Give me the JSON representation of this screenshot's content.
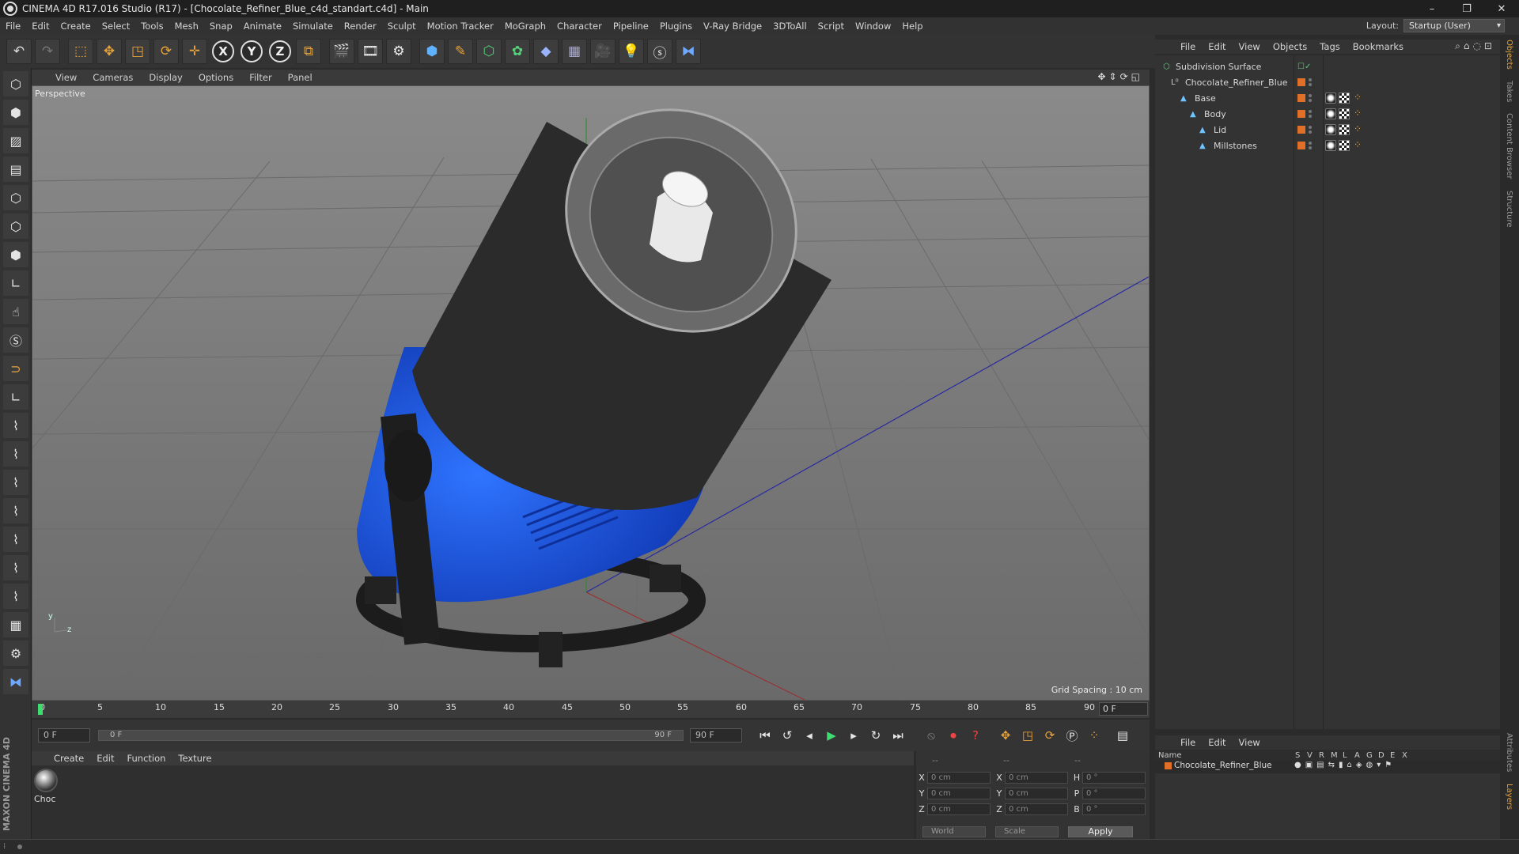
{
  "window": {
    "title": "CINEMA 4D R17.016 Studio (R17) - [Chocolate_Refiner_Blue_c4d_standart.c4d] - Main",
    "controls": [
      "–",
      "❐",
      "✕"
    ]
  },
  "menubar": {
    "items": [
      "File",
      "Edit",
      "Create",
      "Select",
      "Tools",
      "Mesh",
      "Snap",
      "Animate",
      "Simulate",
      "Render",
      "Sculpt",
      "Motion Tracker",
      "MoGraph",
      "Character",
      "Pipeline",
      "Plugins",
      "V-Ray Bridge",
      "3DToAll",
      "Script",
      "Window",
      "Help"
    ],
    "layout_label": "Layout:",
    "layout_value": "Startup (User)"
  },
  "toolbar": {
    "icons": [
      "undo-icon",
      "redo-icon",
      "select-icon",
      "move-icon",
      "scale-icon",
      "rotate-icon",
      "transform-icon",
      "x-axis-icon",
      "y-axis-icon",
      "z-axis-icon",
      "coordinate-system-icon",
      "render-view-icon",
      "render-picture-viewer-icon",
      "edit-render-settings-icon",
      "cube-icon",
      "pen-icon",
      "subdivision-icon",
      "array-icon",
      "deformer-icon",
      "floor-icon",
      "camera-icon",
      "light-icon",
      "script-icon",
      "python-icon"
    ],
    "axis_labels": [
      "X",
      "Y",
      "Z"
    ]
  },
  "viewport": {
    "menu": [
      "View",
      "Cameras",
      "Display",
      "Options",
      "Filter",
      "Panel"
    ],
    "label": "Perspective",
    "grid_spacing": "Grid Spacing : 10 cm",
    "axis_y": "y",
    "axis_z": "z"
  },
  "timeline": {
    "ticks": [
      "0",
      "5",
      "10",
      "15",
      "20",
      "25",
      "30",
      "35",
      "40",
      "45",
      "50",
      "55",
      "60",
      "65",
      "70",
      "75",
      "80",
      "85",
      "90"
    ],
    "current_frame": "0 F"
  },
  "transport": {
    "start_field": "0 F",
    "range_start": "0 F",
    "range_end": "90 F",
    "end_field": "90 F"
  },
  "material_manager": {
    "menu": [
      "Create",
      "Edit",
      "Function",
      "Texture"
    ],
    "material_label": "Choc"
  },
  "coordinates": {
    "header_left": "--",
    "header_mid": "--",
    "header_right": "--",
    "rows": [
      {
        "l1": "X",
        "v1": "0 cm",
        "l2": "X",
        "v2": "0 cm",
        "l3": "H",
        "v3": "0 °"
      },
      {
        "l1": "Y",
        "v1": "0 cm",
        "l2": "Y",
        "v2": "0 cm",
        "l3": "P",
        "v3": "0 °"
      },
      {
        "l1": "Z",
        "v1": "0 cm",
        "l2": "Z",
        "v2": "0 cm",
        "l3": "B",
        "v3": "0 °"
      }
    ],
    "mode": "World",
    "size_mode": "Scale",
    "apply": "Apply"
  },
  "object_manager": {
    "menu": [
      "File",
      "Edit",
      "View",
      "Objects",
      "Tags",
      "Bookmarks"
    ],
    "items": [
      {
        "name": "Subdivision Surface",
        "depth": 0
      },
      {
        "name": "Chocolate_Refiner_Blue",
        "depth": 1
      },
      {
        "name": "Base",
        "depth": 2
      },
      {
        "name": "Body",
        "depth": 3
      },
      {
        "name": "Lid",
        "depth": 4
      },
      {
        "name": "Millstones",
        "depth": 4
      }
    ]
  },
  "attribute_manager": {
    "menu": [
      "File",
      "Edit",
      "View"
    ],
    "columns": [
      "Name",
      "S",
      "V",
      "R",
      "M",
      "L",
      "A",
      "G",
      "D",
      "E",
      "X"
    ],
    "row_name": "Chocolate_Refiner_Blue"
  },
  "side_tabs": [
    "Objects",
    "Takes",
    "Content Browser",
    "Structure",
    "Attributes",
    "Layers"
  ],
  "brand": "MAXON CINEMA 4D",
  "colors": {
    "accent": "#e7a23a",
    "layer": "#e07026",
    "model_blue": "#1f57e6"
  }
}
